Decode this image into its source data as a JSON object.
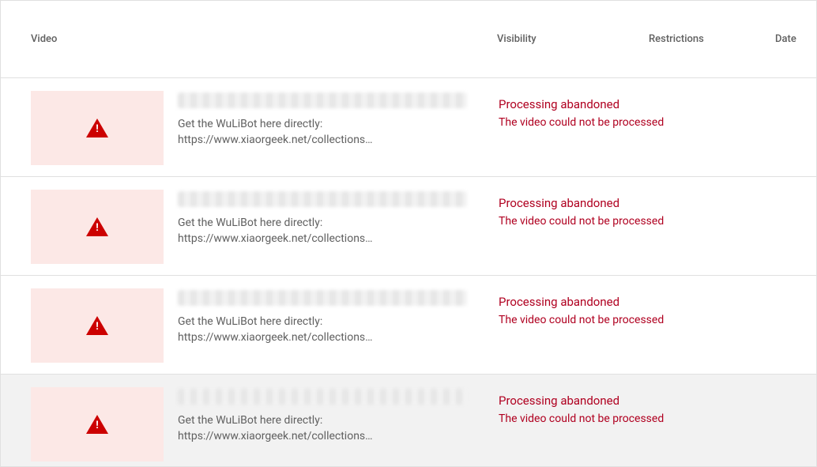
{
  "columns": {
    "video": "Video",
    "visibility": "Visibility",
    "restrictions": "Restrictions",
    "date": "Date"
  },
  "rows": [
    {
      "desc_line1": "Get the WuLiBot here directly:",
      "desc_line2": "https://www.xiaorgeek.net/collections…",
      "status_title": "Processing abandoned",
      "status_sub": "The video could not be processed"
    },
    {
      "desc_line1": "Get the WuLiBot here directly:",
      "desc_line2": "https://www.xiaorgeek.net/collections…",
      "status_title": "Processing abandoned",
      "status_sub": "The video could not be processed"
    },
    {
      "desc_line1": "Get the WuLiBot here directly:",
      "desc_line2": "https://www.xiaorgeek.net/collections…",
      "status_title": "Processing abandoned",
      "status_sub": "The video could not be processed"
    },
    {
      "desc_line1": "Get the WuLiBot here directly:",
      "desc_line2": "https://www.xiaorgeek.net/collections…",
      "status_title": "Processing abandoned",
      "status_sub": "The video could not be processed"
    }
  ]
}
